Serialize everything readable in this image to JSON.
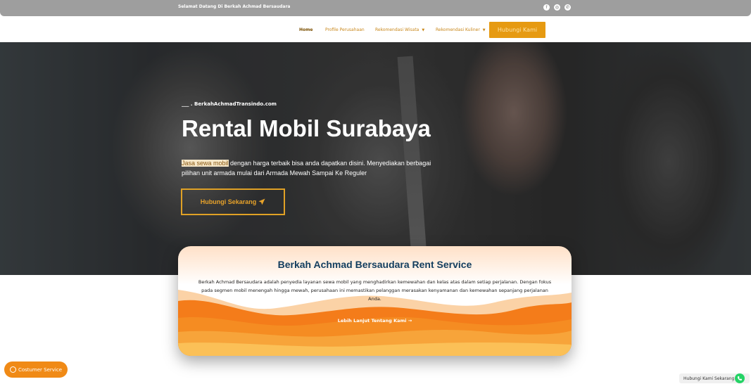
{
  "topbar": {
    "welcome_text": "Selamat Datang Di Berkah Achmad Bersaudara",
    "social_icons": [
      "facebook-icon",
      "instagram-icon",
      "whatsapp-icon"
    ]
  },
  "nav": {
    "items": [
      {
        "label": "Home",
        "active": true
      },
      {
        "label": "Profile Perusahaan",
        "active": false
      },
      {
        "label": "Rekomendasi Wisata",
        "active": false,
        "dropdown": true
      },
      {
        "label": "Rekomendasi Kuliner",
        "active": false,
        "dropdown": true
      }
    ],
    "cta_label": "Hubungi Kami"
  },
  "hero": {
    "tagline": "___ . BerkahAchmadTransindo.com",
    "title": "Rental Mobil Surabaya",
    "highlight": "Jasa sewa mobil",
    "description": " dengan harga terbaik bisa anda dapatkan disini. Menyediakan berbagai pilihan unit armada mulai dari Armada Mewah Sampai Ke Reguler",
    "button_label": "Hubungi Sekarang"
  },
  "card": {
    "title": "Berkah Achmad Bersaudara Rent Service",
    "text": "Berkah Achmad Bersaudara adalah penyedia layanan sewa mobil yang menghadirkan kemewahan dan kelas atas dalam setiap perjalanan. Dengan fokus pada segmen mobil menengah hingga mewah, perusahaan ini memastikan pelanggan merasakan kenyamanan dan kemewahan sepanjang perjalanan Anda.",
    "link_label": "Lebih Lanjut Tentang Kami →"
  },
  "floating": {
    "customer_service_label": "Costumer Service",
    "contact_label": "Hubungi Kami Sekarang"
  },
  "colors": {
    "accent": "#e69a12",
    "topbar": "#9e9e9e",
    "card_title": "#123d5e",
    "whatsapp": "#25d366"
  }
}
